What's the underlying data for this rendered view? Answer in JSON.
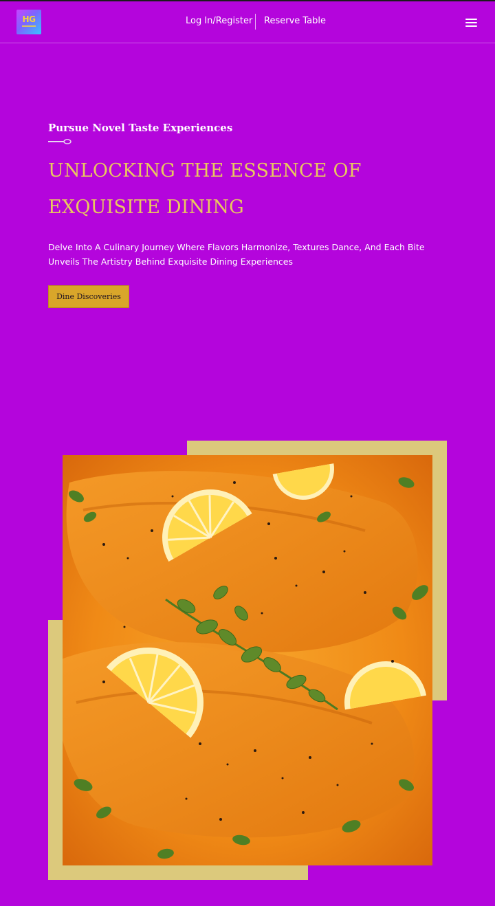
{
  "header": {
    "logo_text": "HG",
    "nav": {
      "login_label": "Log In/Register",
      "reserve_label": "Reserve Table"
    },
    "menu_icon": "hamburger-menu-icon"
  },
  "hero": {
    "eyebrow": "Pursue Novel Taste Experiences",
    "divider_icon": "spoon-icon",
    "headline": "UNLOCKING THE ESSENCE OF EXQUISITE DINING",
    "description": "Delve Into A Culinary Journey Where Flavors Harmonize, Textures Dance, And Each Bite Unveils The Artistry Behind Exquisite Dining Experiences",
    "cta_label": "Dine Discoveries"
  },
  "media": {
    "image_subject": "salmon-with-lemon-and-oregano"
  },
  "colors": {
    "background": "#b405dc",
    "headline": "#e8c95e",
    "button": "#d9a62a",
    "frame": "#dcc97c"
  }
}
